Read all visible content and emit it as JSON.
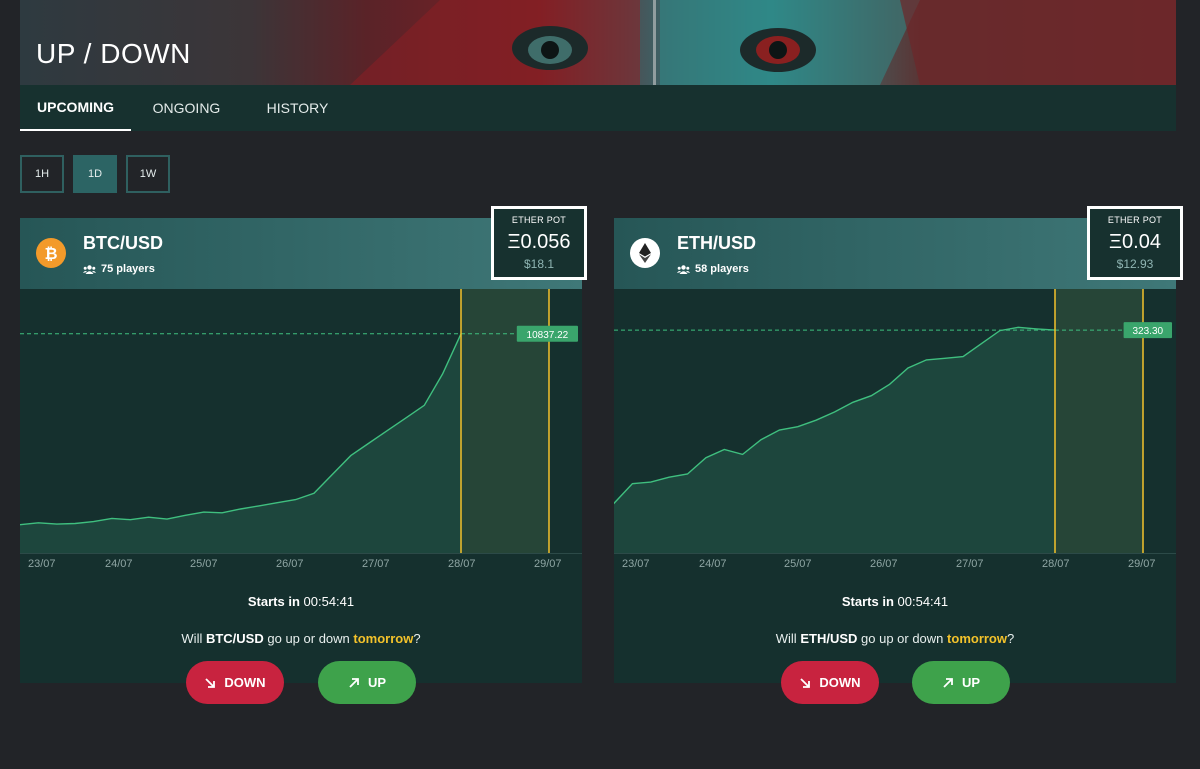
{
  "header": {
    "title": "UP / DOWN"
  },
  "tabs": [
    {
      "label": "UPCOMING",
      "active": true
    },
    {
      "label": "ONGOING",
      "active": false
    },
    {
      "label": "HISTORY",
      "active": false
    }
  ],
  "periods": [
    {
      "label": "1H",
      "active": false
    },
    {
      "label": "1D",
      "active": true
    },
    {
      "label": "1W",
      "active": false
    }
  ],
  "markets": [
    {
      "pair": "BTC/USD",
      "icon": "bitcoin-icon",
      "players": "75 players",
      "pot_label": "ETHER POT",
      "pot_eth": "Ξ0.056",
      "pot_usd": "$18.1",
      "price_label": "10837.22",
      "starts_prefix": "Starts in",
      "starts_time": "00:54:41",
      "question_prefix": "Will",
      "question_middle": "go up or down",
      "question_when": "tomorrow",
      "question_suffix": "?",
      "down_label": "DOWN",
      "up_label": "UP"
    },
    {
      "pair": "ETH/USD",
      "icon": "ethereum-icon",
      "players": "58 players",
      "pot_label": "ETHER POT",
      "pot_eth": "Ξ0.04",
      "pot_usd": "$12.93",
      "price_label": "323.30",
      "starts_prefix": "Starts in",
      "starts_time": "00:54:41",
      "question_prefix": "Will",
      "question_middle": "go up or down",
      "question_when": "tomorrow",
      "question_suffix": "?",
      "down_label": "DOWN",
      "up_label": "UP"
    }
  ],
  "colors": {
    "background": "#222428",
    "panel": "#15302e",
    "accent_line": "#3fbf7f",
    "window_line": "#f3c22b",
    "down": "#c8233f",
    "up": "#3ea24b",
    "highlight": "#f3c22b"
  },
  "chart_data": [
    {
      "type": "area",
      "series": [
        {
          "values": [
            7800,
            7830,
            7810,
            7820,
            7850,
            7900,
            7880,
            7920,
            7890,
            7950,
            8000,
            7990,
            8050,
            8100,
            8150,
            8200,
            8300,
            8600,
            8900,
            9100,
            9300,
            9500,
            9700,
            10200,
            10837.22
          ]
        }
      ],
      "x_tick_labels": [
        "23/07",
        "24/07",
        "25/07",
        "26/07",
        "27/07",
        "28/07",
        "29/07"
      ],
      "current_value": 10837.22
    },
    {
      "type": "area",
      "series": [
        {
          "values": [
            217,
            229,
            230,
            233,
            235,
            245,
            250,
            247,
            256,
            262,
            264,
            268,
            273,
            279,
            283,
            290,
            300,
            305,
            306,
            307,
            315,
            323,
            325,
            324,
            323.3
          ]
        }
      ],
      "x_tick_labels": [
        "23/07",
        "24/07",
        "25/07",
        "26/07",
        "27/07",
        "28/07",
        "29/07"
      ],
      "current_value": 323.3
    }
  ]
}
